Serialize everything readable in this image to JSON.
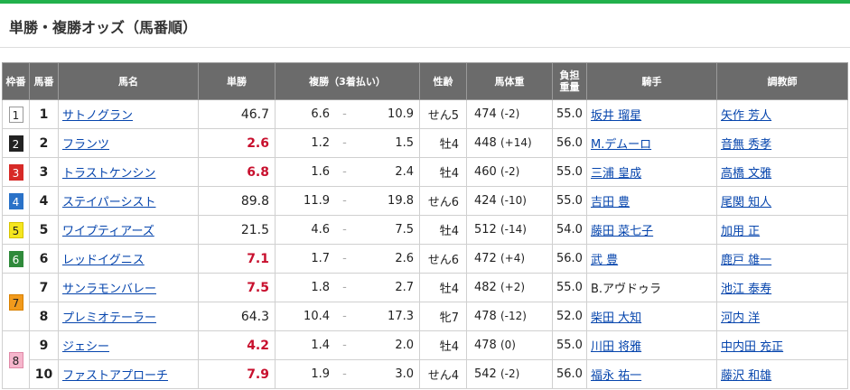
{
  "page": {
    "title": "単勝・複勝オッズ（馬番順）",
    "accent_color": "#22b14c"
  },
  "table": {
    "headers": {
      "waku": "枠番",
      "umaban": "馬番",
      "name": "馬名",
      "win": "単勝",
      "place": "複勝（3着払い）",
      "sex_age": "性齢",
      "body_weight": "馬体重",
      "burden_1": "負担",
      "burden_2": "重量",
      "jockey": "騎手",
      "trainer": "調教師"
    },
    "rows": [
      {
        "waku": "1",
        "umaban": "1",
        "name": "サトノグラン",
        "win": "46.7",
        "place_lo": "6.6",
        "place_hi": "10.9",
        "sex_age": "せん5",
        "weight": "474",
        "weight_diff": "(-2)",
        "burden": "55.0",
        "jockey": "坂井 瑠星",
        "trainer": "矢作 芳人"
      },
      {
        "waku": "2",
        "umaban": "2",
        "name": "フランツ",
        "win": "2.6",
        "place_lo": "1.2",
        "place_hi": "1.5",
        "sex_age": "牡4",
        "weight": "448",
        "weight_diff": "(+14)",
        "burden": "56.0",
        "jockey": "M.デムーロ",
        "trainer": "音無 秀孝"
      },
      {
        "waku": "3",
        "umaban": "3",
        "name": "トラストケンシン",
        "win": "6.8",
        "place_lo": "1.6",
        "place_hi": "2.4",
        "sex_age": "牡4",
        "weight": "460",
        "weight_diff": "(-2)",
        "burden": "55.0",
        "jockey": "三浦 皇成",
        "trainer": "高橋 文雅"
      },
      {
        "waku": "4",
        "umaban": "4",
        "name": "ステイパーシスト",
        "win": "89.8",
        "place_lo": "11.9",
        "place_hi": "19.8",
        "sex_age": "せん6",
        "weight": "424",
        "weight_diff": "(-10)",
        "burden": "55.0",
        "jockey": "吉田 豊",
        "trainer": "尾関 知人"
      },
      {
        "waku": "5",
        "umaban": "5",
        "name": "ワイプティアーズ",
        "win": "21.5",
        "place_lo": "4.6",
        "place_hi": "7.5",
        "sex_age": "牡4",
        "weight": "512",
        "weight_diff": "(-14)",
        "burden": "54.0",
        "jockey": "藤田 菜七子",
        "trainer": "加用 正"
      },
      {
        "waku": "6",
        "umaban": "6",
        "name": "レッドイグニス",
        "win": "7.1",
        "place_lo": "1.7",
        "place_hi": "2.6",
        "sex_age": "せん6",
        "weight": "472",
        "weight_diff": "(+4)",
        "burden": "56.0",
        "jockey": "武 豊",
        "trainer": "鹿戸 雄一"
      },
      {
        "waku": "7",
        "umaban": "7",
        "name": "サンラモンバレー",
        "win": "7.5",
        "place_lo": "1.8",
        "place_hi": "2.7",
        "sex_age": "牡4",
        "weight": "482",
        "weight_diff": "(+2)",
        "burden": "55.0",
        "jockey": "B.アヴドゥラ",
        "trainer": "池江 泰寿"
      },
      {
        "waku": "7",
        "umaban": "8",
        "name": "プレミオテーラー",
        "win": "64.3",
        "place_lo": "10.4",
        "place_hi": "17.3",
        "sex_age": "牝7",
        "weight": "478",
        "weight_diff": "(-12)",
        "burden": "52.0",
        "jockey": "柴田 大知",
        "trainer": "河内 洋"
      },
      {
        "waku": "8",
        "umaban": "9",
        "name": "ジェシー",
        "win": "4.2",
        "place_lo": "1.4",
        "place_hi": "2.0",
        "sex_age": "牡4",
        "weight": "478",
        "weight_diff": "(0)",
        "burden": "55.0",
        "jockey": "川田 将雅",
        "trainer": "中内田 充正"
      },
      {
        "waku": "8",
        "umaban": "10",
        "name": "ファストアプローチ",
        "win": "7.9",
        "place_lo": "1.9",
        "place_hi": "3.0",
        "sex_age": "せん4",
        "weight": "542",
        "weight_diff": "(-2)",
        "burden": "56.0",
        "jockey": "福永 祐一",
        "trainer": "藤沢 和雄"
      }
    ]
  }
}
